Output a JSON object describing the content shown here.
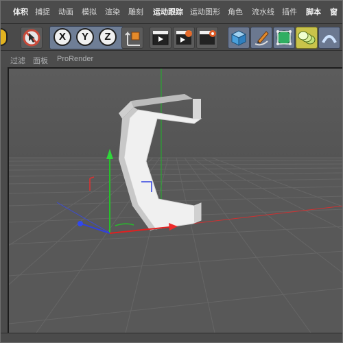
{
  "menubar": {
    "items": [
      "体积",
      "捕捉",
      "动画",
      "模拟",
      "渲染",
      "雕刻",
      "运动跟踪",
      "运动图形",
      "角色",
      "流水线",
      "插件",
      "脚本",
      "窗"
    ]
  },
  "toolbar": {
    "axis_x": "X",
    "axis_y": "Y",
    "axis_z": "Z"
  },
  "viewmenu": {
    "items": [
      "过滤",
      "面板",
      "ProRender"
    ]
  },
  "colors": {
    "x_axis": "#e02020",
    "y_axis": "#20c020",
    "z_axis": "#2040e0",
    "model": "#e9e9e9",
    "viewport_bg": "#565656"
  }
}
